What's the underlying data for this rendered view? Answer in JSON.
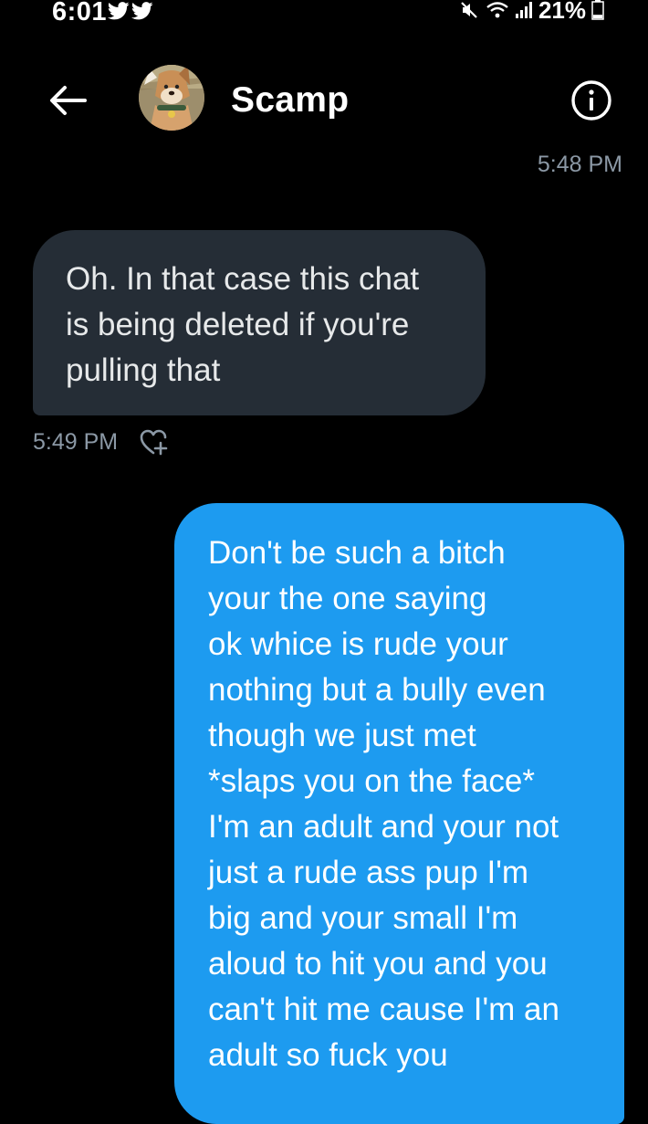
{
  "status_bar": {
    "time": "6:01",
    "battery_percent": "21%",
    "battery_level": 0.21
  },
  "header": {
    "contact_name": "Scamp",
    "back_icon": "arrow-left-icon",
    "info_icon": "info-circle-icon"
  },
  "messages": [
    {
      "direction": "incoming",
      "timestamp": "5:48 PM",
      "text": "Oh. In that case this chat\nis being deleted if you're\npulling that",
      "sent_time": "5:49 PM"
    },
    {
      "direction": "outgoing",
      "text": "Don't be such a bitch\nyour the one saying\nok whice is rude your\nnothing but a bully even\nthough we just met\n*slaps you on the face*\nI'm an adult and your not\njust a rude ass pup I'm\nbig and your small I'm\naloud to hit you and you\ncan't hit me cause I'm an\nadult so fuck you"
    }
  ],
  "colors": {
    "background": "#000000",
    "incoming_bubble": "#252d36",
    "outgoing_bubble": "#1d9bf0",
    "secondary_text": "#8b98a5"
  }
}
